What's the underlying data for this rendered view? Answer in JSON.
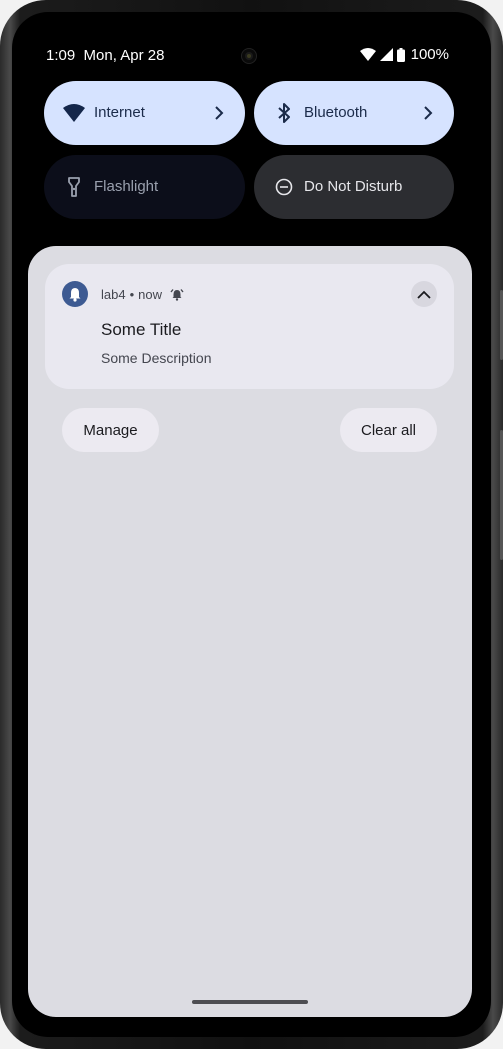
{
  "status_bar": {
    "time": "1:09",
    "date": "Mon, Apr 28",
    "battery": "100%"
  },
  "quick_settings": {
    "tiles": [
      {
        "label": "Internet",
        "icon": "wifi-icon",
        "state": "on",
        "has_chevron": true
      },
      {
        "label": "Bluetooth",
        "icon": "bluetooth-icon",
        "state": "on",
        "has_chevron": true
      },
      {
        "label": "Flashlight",
        "icon": "flashlight-icon",
        "state": "off",
        "has_chevron": false
      },
      {
        "label": "Do Not Disturb",
        "icon": "do-not-disturb-icon",
        "state": "off",
        "has_chevron": false
      }
    ]
  },
  "notification": {
    "app_name": "lab4",
    "separator": "•",
    "time": "now",
    "title": "Some Title",
    "description": "Some Description",
    "icon": "bell-icon"
  },
  "actions": {
    "manage": "Manage",
    "clear_all": "Clear all"
  },
  "colors": {
    "tile_on_bg": "#d6e3ff",
    "tile_off_bg": "#0c0e1a",
    "dnd_bg": "#2c2d31",
    "shade_bg": "#dcdce2",
    "card_bg": "#e9e8f0",
    "app_icon_bg": "#3d5a92"
  }
}
